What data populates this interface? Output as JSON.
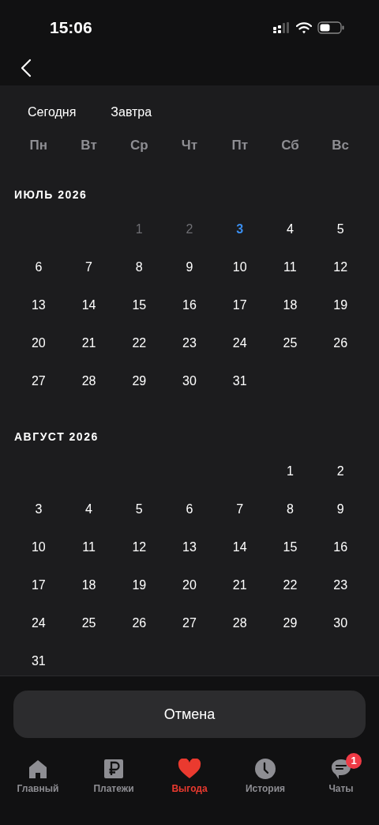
{
  "status_bar": {
    "time": "15:06"
  },
  "quick_picks": [
    "Сегодня",
    "Завтра"
  ],
  "weekdays": [
    "Пн",
    "Вт",
    "Ср",
    "Чт",
    "Пт",
    "Сб",
    "Вс"
  ],
  "months": [
    {
      "title": "ИЮЛЬ 2026",
      "weeks": [
        [
          {
            "d": "1",
            "disabled": true,
            "today": false
          },
          {
            "d": "2",
            "disabled": true,
            "today": false
          },
          {
            "d": "3",
            "disabled": false,
            "today": true
          },
          {
            "d": "4",
            "disabled": false,
            "today": false
          },
          {
            "d": "5",
            "disabled": false,
            "today": false
          }
        ],
        [
          {
            "d": "6",
            "disabled": false,
            "today": false
          },
          {
            "d": "7",
            "disabled": false,
            "today": false
          },
          {
            "d": "8",
            "disabled": false,
            "today": false
          },
          {
            "d": "9",
            "disabled": false,
            "today": false
          },
          {
            "d": "10",
            "disabled": false,
            "today": false
          },
          {
            "d": "11",
            "disabled": false,
            "today": false
          },
          {
            "d": "12",
            "disabled": false,
            "today": false
          }
        ],
        [
          {
            "d": "13",
            "disabled": false,
            "today": false
          },
          {
            "d": "14",
            "disabled": false,
            "today": false
          },
          {
            "d": "15",
            "disabled": false,
            "today": false
          },
          {
            "d": "16",
            "disabled": false,
            "today": false
          },
          {
            "d": "17",
            "disabled": false,
            "today": false
          },
          {
            "d": "18",
            "disabled": false,
            "today": false
          },
          {
            "d": "19",
            "disabled": false,
            "today": false
          }
        ],
        [
          {
            "d": "20",
            "disabled": false,
            "today": false
          },
          {
            "d": "21",
            "disabled": false,
            "today": false
          },
          {
            "d": "22",
            "disabled": false,
            "today": false
          },
          {
            "d": "23",
            "disabled": false,
            "today": false
          },
          {
            "d": "24",
            "disabled": false,
            "today": false
          },
          {
            "d": "25",
            "disabled": false,
            "today": false
          },
          {
            "d": "26",
            "disabled": false,
            "today": false
          }
        ],
        [
          {
            "d": "27",
            "disabled": false,
            "today": false
          },
          {
            "d": "28",
            "disabled": false,
            "today": false
          },
          {
            "d": "29",
            "disabled": false,
            "today": false
          },
          {
            "d": "30",
            "disabled": false,
            "today": false
          },
          {
            "d": "31",
            "disabled": false,
            "today": false
          }
        ]
      ]
    },
    {
      "title": "АВГУСТ 2026",
      "weeks": [
        [
          {
            "d": "1",
            "disabled": false,
            "today": false
          },
          {
            "d": "2",
            "disabled": false,
            "today": false
          }
        ],
        [
          {
            "d": "3",
            "disabled": false,
            "today": false
          },
          {
            "d": "4",
            "disabled": false,
            "today": false
          },
          {
            "d": "5",
            "disabled": false,
            "today": false
          },
          {
            "d": "6",
            "disabled": false,
            "today": false
          },
          {
            "d": "7",
            "disabled": false,
            "today": false
          },
          {
            "d": "8",
            "disabled": false,
            "today": false
          },
          {
            "d": "9",
            "disabled": false,
            "today": false
          }
        ],
        [
          {
            "d": "10",
            "disabled": false,
            "today": false
          },
          {
            "d": "11",
            "disabled": false,
            "today": false
          },
          {
            "d": "12",
            "disabled": false,
            "today": false
          },
          {
            "d": "13",
            "disabled": false,
            "today": false
          },
          {
            "d": "14",
            "disabled": false,
            "today": false
          },
          {
            "d": "15",
            "disabled": false,
            "today": false
          },
          {
            "d": "16",
            "disabled": false,
            "today": false
          }
        ],
        [
          {
            "d": "17",
            "disabled": false,
            "today": false
          },
          {
            "d": "18",
            "disabled": false,
            "today": false
          },
          {
            "d": "19",
            "disabled": false,
            "today": false
          },
          {
            "d": "20",
            "disabled": false,
            "today": false
          },
          {
            "d": "21",
            "disabled": false,
            "today": false
          },
          {
            "d": "22",
            "disabled": false,
            "today": false
          },
          {
            "d": "23",
            "disabled": false,
            "today": false
          }
        ],
        [
          {
            "d": "24",
            "disabled": false,
            "today": false
          },
          {
            "d": "25",
            "disabled": false,
            "today": false
          },
          {
            "d": "26",
            "disabled": false,
            "today": false
          },
          {
            "d": "27",
            "disabled": false,
            "today": false
          },
          {
            "d": "28",
            "disabled": false,
            "today": false
          },
          {
            "d": "29",
            "disabled": false,
            "today": false
          },
          {
            "d": "30",
            "disabled": false,
            "today": false
          }
        ],
        [
          {
            "d": "31",
            "disabled": false,
            "today": false
          }
        ]
      ]
    }
  ],
  "cancel_button": "Отмена",
  "tab_bar": [
    {
      "label": "Главный",
      "kind": "home",
      "selected": false
    },
    {
      "label": "Платежи",
      "kind": "payments",
      "selected": false
    },
    {
      "label": "Выгода",
      "kind": "heart",
      "selected": true
    },
    {
      "label": "История",
      "kind": "clock",
      "selected": false
    },
    {
      "label": "Чаты",
      "kind": "chat",
      "selected": false,
      "badge": "1"
    }
  ]
}
